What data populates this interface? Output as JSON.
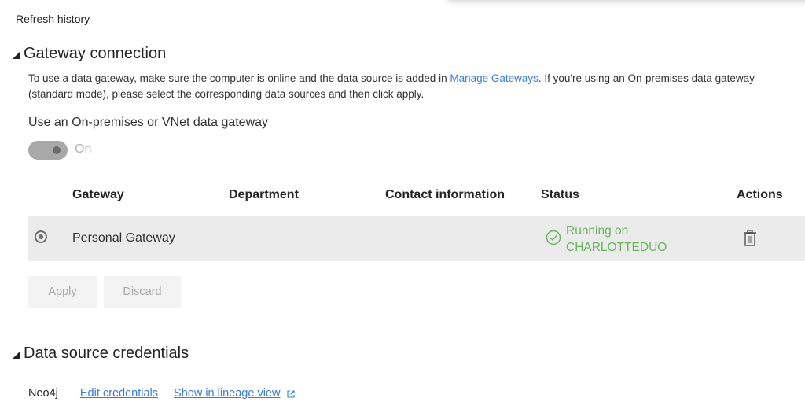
{
  "refresh_history_link": "Refresh history",
  "gateway_section": {
    "title": "Gateway connection",
    "description_before_link": "To use a data gateway, make sure the computer is online and the data source is added in ",
    "manage_gateways_link": "Manage Gateways",
    "description_after_link": ". If you're using an On-premises data gateway (standard mode), please select the corresponding data sources and then click apply.",
    "toggle_label": "Use an On-premises or VNet data gateway",
    "toggle_state": "On",
    "toggle_on": true,
    "table": {
      "headers": [
        "Gateway",
        "Department",
        "Contact information",
        "Status",
        "Actions"
      ],
      "rows": [
        {
          "selected": true,
          "gateway": "Personal Gateway",
          "department": "",
          "contact": "",
          "status_line1": "Running on",
          "status_line2": "CHARLOTTEDUO",
          "status_icon": "check-circle-icon",
          "action_icon": "trash-icon"
        }
      ]
    },
    "apply_label": "Apply",
    "discard_label": "Discard"
  },
  "credentials_section": {
    "title": "Data source credentials",
    "items": [
      {
        "name": "Neo4j",
        "edit_link": "Edit credentials",
        "lineage_link": "Show in lineage view",
        "lineage_icon": "external-link-icon"
      }
    ]
  },
  "colors": {
    "link": "#3a7bd5",
    "status_ok": "#6bb35f",
    "row_selected_bg": "#ebebeb",
    "button_disabled_bg": "#f3f3f3"
  }
}
